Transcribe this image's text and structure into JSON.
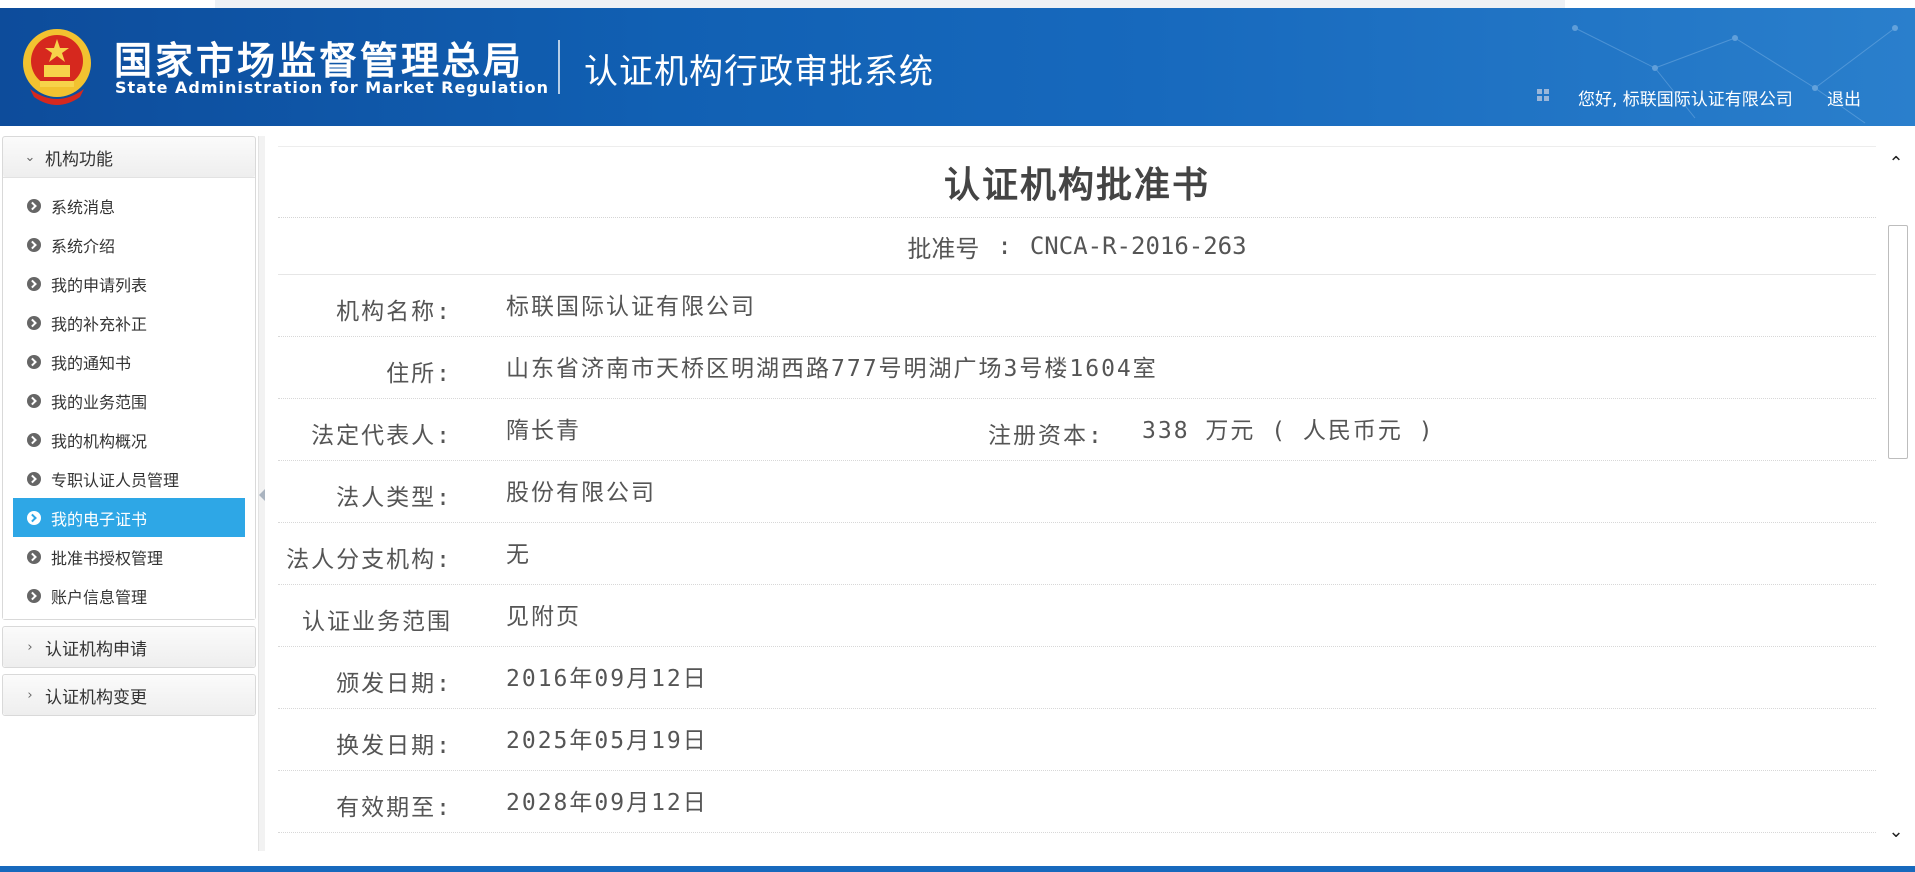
{
  "header": {
    "brand_cn": "国家市场监督管理总局",
    "brand_en": "State Administration  for  Market Regulation",
    "system_title": "认证机构行政审批系统",
    "greeting": "您好, 标联国际认证有限公司",
    "logout_label": "退出"
  },
  "sidebar": {
    "groups": [
      {
        "label": "机构功能",
        "items": [
          "系统消息",
          "系统介绍",
          "我的申请列表",
          "我的补充补正",
          "我的通知书",
          "我的业务范围",
          "我的机构概况",
          "专职认证人员管理",
          "我的电子证书",
          "批准书授权管理",
          "账户信息管理"
        ]
      },
      {
        "label": "认证机构申请"
      },
      {
        "label": "认证机构变更"
      }
    ]
  },
  "document": {
    "title": "认证机构批准书",
    "no_label": "批准号",
    "no_sep": ":",
    "no_value": "CNCA-R-2016-263",
    "fields": {
      "name": {
        "label": "机构名称:",
        "value": "标联国际认证有限公司"
      },
      "address": {
        "label": "住所:",
        "value": "山东省济南市天桥区明湖西路777号明湖广场3号楼1604室"
      },
      "legal_rep": {
        "label": "法定代表人:",
        "value": "隋长青"
      },
      "capital": {
        "label": "注册资本:",
        "value": "338 万元 ( 人民币元 )"
      },
      "entity_type": {
        "label": "法人类型:",
        "value": "股份有限公司"
      },
      "branches": {
        "label": "法人分支机构:",
        "value": "无"
      },
      "scope": {
        "label": "认证业务范围",
        "value": "见附页"
      },
      "issue_date": {
        "label": "颁发日期:",
        "value": "2016年09月12日"
      },
      "renew_date": {
        "label": "换发日期:",
        "value": "2025年05月19日"
      },
      "expire_date": {
        "label": "有效期至:",
        "value": "2028年09月12日"
      }
    }
  },
  "colors": {
    "header_blue": "#1160b3",
    "active_item": "#2ea7e6",
    "bullet": "#666666"
  },
  "icons": {
    "scroll_up": "chevron-up-icon",
    "scroll_down": "chevron-down-icon",
    "menu": "grid-icon",
    "group_open": "chevron-down-icon",
    "group_closed": "chevron-right-icon"
  }
}
